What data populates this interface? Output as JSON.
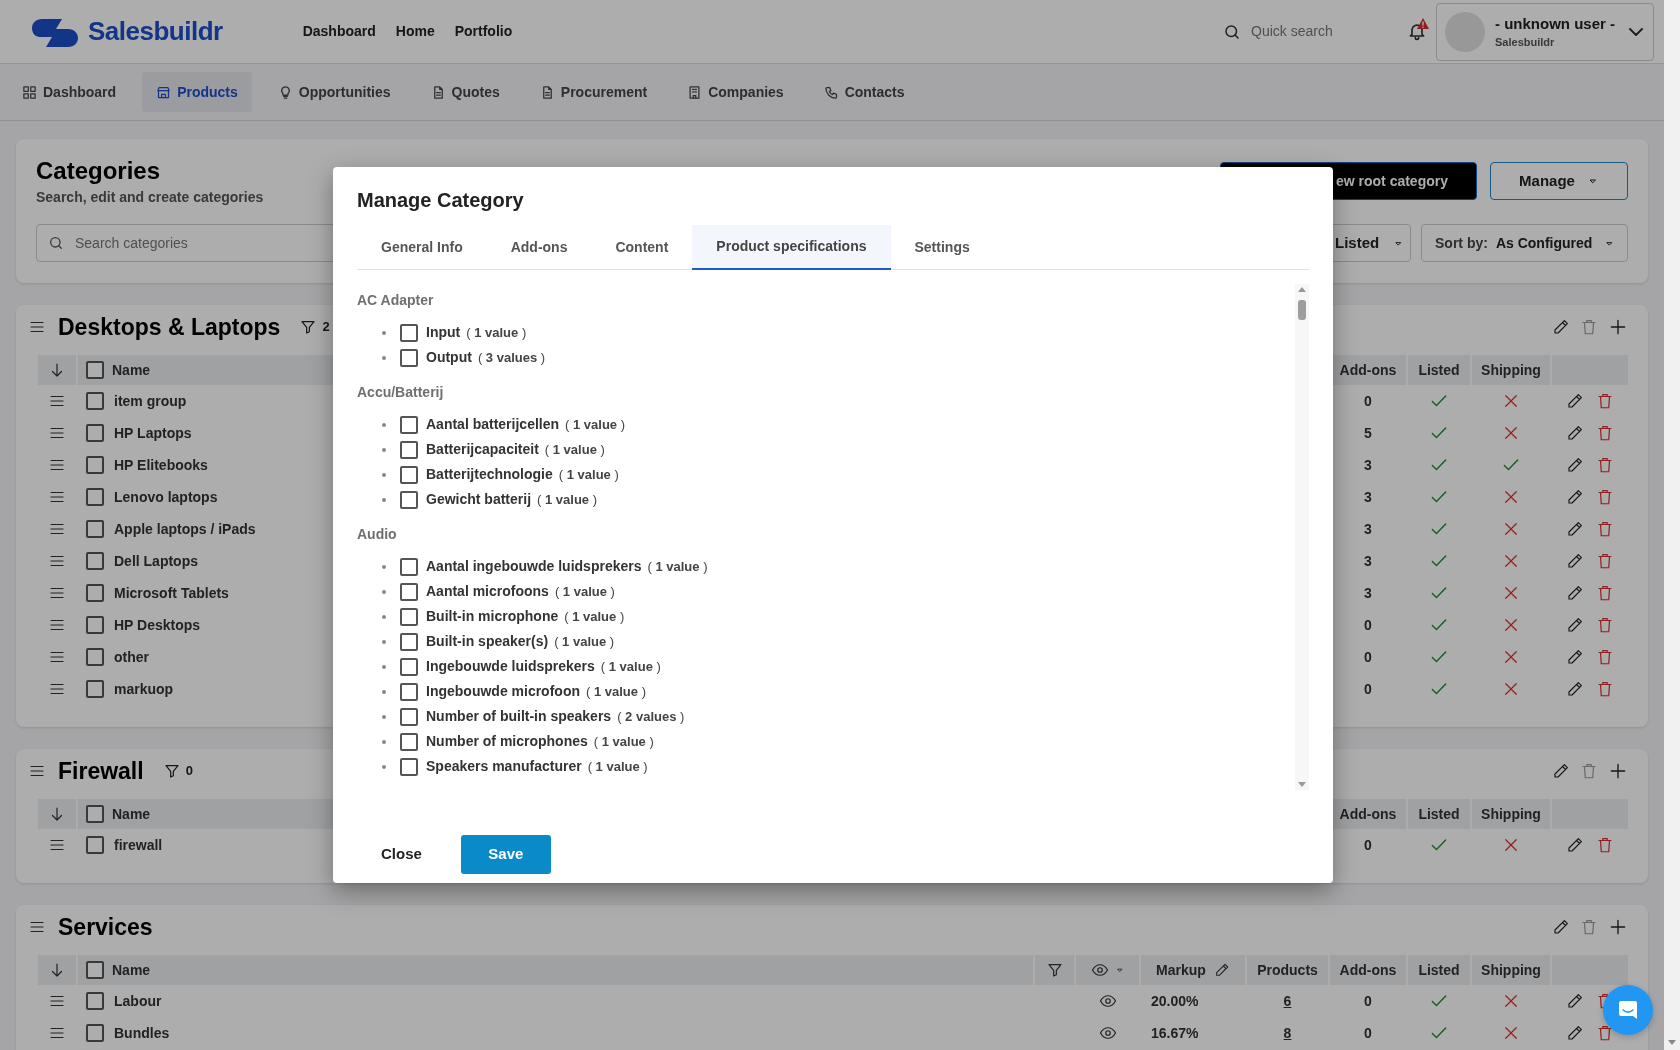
{
  "header": {
    "logo": "Salesbuildr",
    "nav": [
      "Dashboard",
      "Home",
      "Portfolio"
    ],
    "search": {
      "placeholder": "Quick search"
    },
    "notifications": {
      "alert": true
    },
    "user": {
      "name": "- unknown user -",
      "company": "Salesbuildr"
    }
  },
  "nav_tabs": [
    {
      "label": "Dashboard",
      "kind": "grid",
      "selected": false
    },
    {
      "label": "Products",
      "kind": "store",
      "selected": true
    },
    {
      "label": "Opportunities",
      "kind": "bulb",
      "selected": false
    },
    {
      "label": "Quotes",
      "kind": "document",
      "selected": false
    },
    {
      "label": "Procurement",
      "kind": "document",
      "selected": false
    },
    {
      "label": "Companies",
      "kind": "building",
      "selected": false
    },
    {
      "label": "Contacts",
      "kind": "phone",
      "selected": false
    }
  ],
  "categories_panel": {
    "title": "Categories",
    "subtitle": "Search, edit and create categories",
    "search": {
      "placeholder": "Search categories"
    },
    "new_button": "ew root category",
    "manage_button": "Manage",
    "listed_filter": "Listed",
    "sort": {
      "label": "Sort by:",
      "value": "As Configured"
    }
  },
  "groups": [
    {
      "kind": "covered",
      "title": "Desktops & Laptops",
      "filter_count": "2",
      "delete_disabled": true,
      "all_checked": false,
      "columns": {
        "name": "Name",
        "add_ons": "Add-ons",
        "listed": "Listed",
        "shipping": "Shipping"
      },
      "rows": [
        {
          "name": "item group",
          "add_ons": "0",
          "listed": true,
          "shipping": false,
          "checked": false
        },
        {
          "name": "HP Laptops",
          "add_ons": "5",
          "listed": true,
          "shipping": false,
          "checked": false
        },
        {
          "name": "HP Elitebooks",
          "add_ons": "3",
          "listed": true,
          "shipping": true,
          "checked": false
        },
        {
          "name": "Lenovo laptops",
          "add_ons": "3",
          "listed": true,
          "shipping": false,
          "checked": false
        },
        {
          "name": "Apple laptops / iPads",
          "add_ons": "3",
          "listed": true,
          "shipping": false,
          "checked": false
        },
        {
          "name": "Dell Laptops",
          "add_ons": "3",
          "listed": true,
          "shipping": false,
          "checked": false
        },
        {
          "name": "Microsoft Tablets",
          "add_ons": "3",
          "listed": true,
          "shipping": false,
          "checked": false
        },
        {
          "name": "HP Desktops",
          "add_ons": "0",
          "listed": true,
          "shipping": false,
          "checked": false
        },
        {
          "name": "other",
          "add_ons": "0",
          "listed": true,
          "shipping": false,
          "checked": false
        },
        {
          "name": "markuop",
          "add_ons": "0",
          "listed": true,
          "shipping": false,
          "checked": false
        }
      ]
    },
    {
      "kind": "covered",
      "title": "Firewall",
      "filter_count": "0",
      "delete_disabled": true,
      "all_checked": false,
      "columns": {
        "name": "Name",
        "add_ons": "Add-ons",
        "listed": "Listed",
        "shipping": "Shipping"
      },
      "rows": [
        {
          "name": "firewall",
          "add_ons": "0",
          "listed": true,
          "shipping": false,
          "checked": false
        }
      ]
    },
    {
      "kind": "full",
      "title": "Services",
      "delete_disabled": true,
      "all_checked": false,
      "columns": {
        "name": "Name",
        "markup": "Markup",
        "products": "Products",
        "add_ons": "Add-ons",
        "listed": "Listed",
        "shipping": "Shipping"
      },
      "rows": [
        {
          "name": "Labour",
          "visible": true,
          "markup": "20.00%",
          "products": "6",
          "add_ons": "0",
          "listed": true,
          "shipping": false,
          "checked": false
        },
        {
          "name": "Bundles",
          "visible": true,
          "markup": "16.67%",
          "products": "8",
          "add_ons": "0",
          "listed": true,
          "shipping": false,
          "checked": false
        }
      ]
    }
  ],
  "modal": {
    "title": "Manage Category",
    "tabs": [
      {
        "label": "General Info",
        "selected": false
      },
      {
        "label": "Add-ons",
        "selected": false
      },
      {
        "label": "Content",
        "selected": false
      },
      {
        "label": "Product specifications",
        "selected": true
      },
      {
        "label": "Settings",
        "selected": false
      }
    ],
    "spec_groups": [
      {
        "title": "AC Adapter",
        "items": [
          {
            "label": "Input",
            "count": "( **1 value** )",
            "checked": false
          },
          {
            "label": "Output",
            "count": "( **3 values** )",
            "checked": false
          }
        ]
      },
      {
        "title": "Accu/Batterij",
        "items": [
          {
            "label": "Aantal batterijcellen",
            "count": "( **1 value** )",
            "checked": false
          },
          {
            "label": "Batterijcapaciteit",
            "count": "( **1 value** )",
            "checked": false
          },
          {
            "label": "Batterijtechnologie",
            "count": "( **1 value** )",
            "checked": false
          },
          {
            "label": "Gewicht batterij",
            "count": "( **1 value** )",
            "checked": false
          }
        ]
      },
      {
        "title": "Audio",
        "items": [
          {
            "label": "Aantal ingebouwde luidsprekers",
            "count": "( **1 value** )",
            "checked": false
          },
          {
            "label": "Aantal microfoons",
            "count": "( **1 value** )",
            "checked": false
          },
          {
            "label": "Built-in microphone",
            "count": "( **1 value** )",
            "checked": false
          },
          {
            "label": "Built-in speaker(s)",
            "count": "( **1 value** )",
            "checked": false
          },
          {
            "label": "Ingebouwde luidsprekers",
            "count": "( **1 value** )",
            "checked": false
          },
          {
            "label": "Ingebouwde microfoon",
            "count": "( **1 value** )",
            "checked": false
          },
          {
            "label": "Number of built-in speakers",
            "count": "( **2 values** )",
            "checked": false
          },
          {
            "label": "Number of microphones",
            "count": "( **1 value** )",
            "checked": false
          },
          {
            "label": "Speakers manufacturer",
            "count": "( **1 value** )",
            "checked": false
          }
        ]
      }
    ],
    "close_button": "Close",
    "save_button": "Save"
  }
}
